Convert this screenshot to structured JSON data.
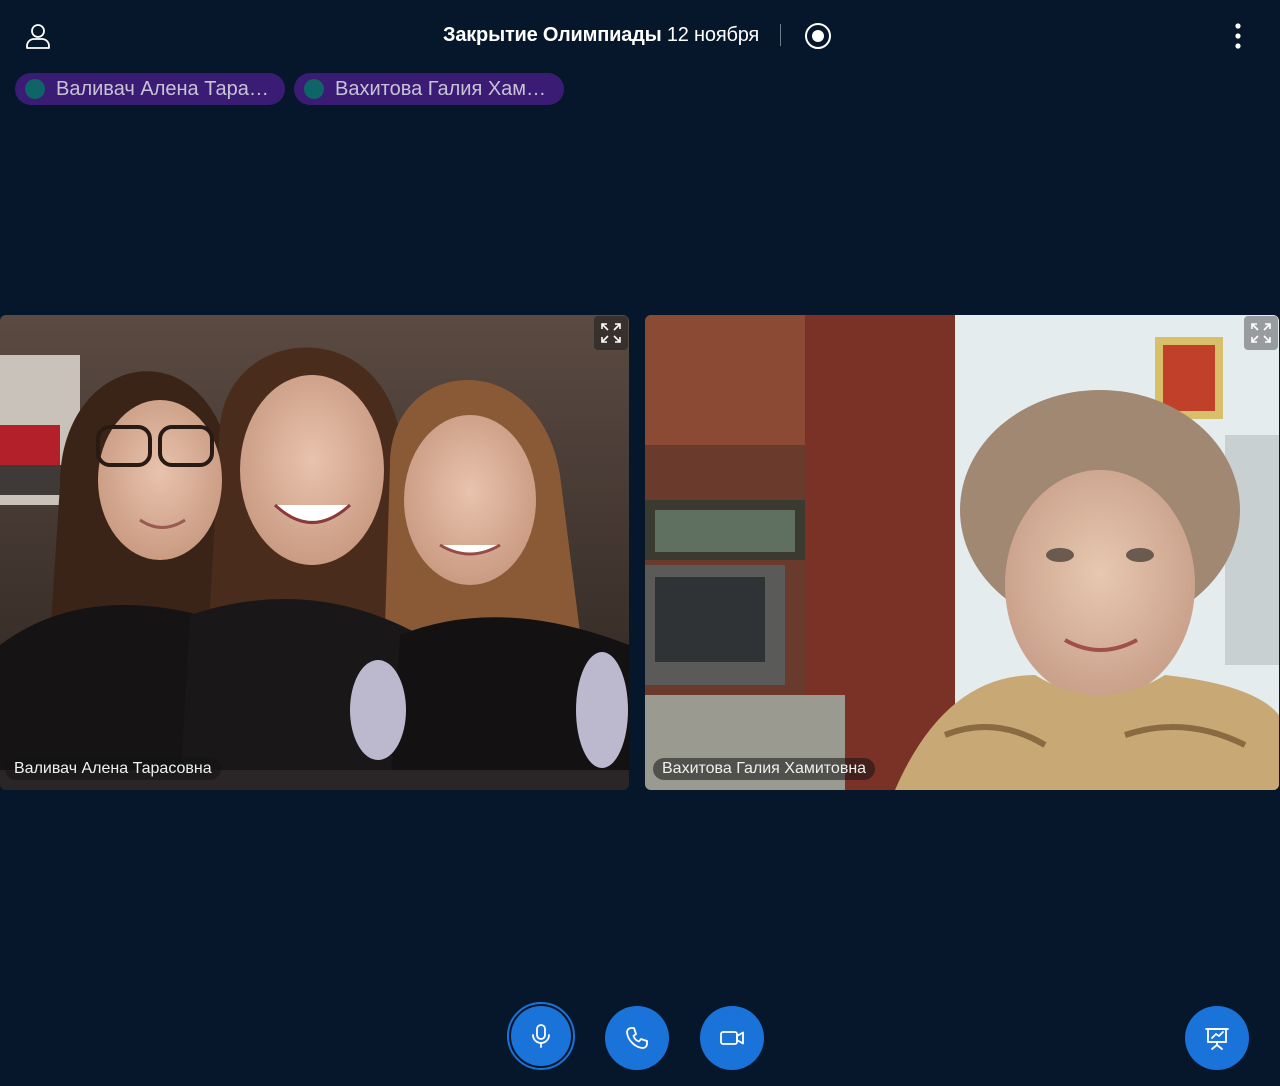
{
  "header": {
    "title": "Закрытие Олимпиады",
    "date": "12 ноября"
  },
  "speakers": [
    {
      "name": "Валивач Алена Тарасовна"
    },
    {
      "name": "Вахитова Галия Хамитовна"
    }
  ],
  "tiles": [
    {
      "label": "Валивач Алена Тарасовна"
    },
    {
      "label": "Вахитова Галия Хамитовна"
    }
  ],
  "colors": {
    "background": "#06172b",
    "chip": "#3a1c74",
    "chip_dot": "#0e6466",
    "control": "#1a73d9"
  },
  "icons": {
    "user": "user-icon",
    "record": "record-icon",
    "more": "more-vertical-icon",
    "expand": "expand-icon",
    "mic": "microphone-icon",
    "phone": "phone-icon",
    "camera": "video-camera-icon",
    "share": "screen-share-icon"
  }
}
